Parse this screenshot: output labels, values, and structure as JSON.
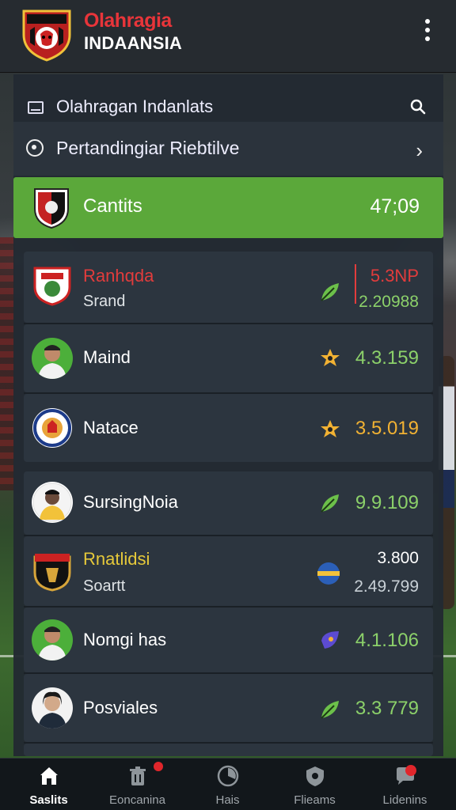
{
  "header": {
    "brand_line1": "Olahragia",
    "brand_line2": "INDAANSIA"
  },
  "search": {
    "label": "Olahragan Indanlats"
  },
  "nav_row": {
    "label": "Pertandingiar Riebtilve"
  },
  "highlight": {
    "title": "Cantits",
    "value": "47;09",
    "color": "#5ba83a"
  },
  "list": [
    {
      "name": "Ranhqda",
      "sub": "Srand",
      "value": "5.3NP",
      "value2": "2.20988",
      "name_color": "#e23c3c"
    },
    {
      "name": "Maind",
      "value": "4.3.159"
    },
    {
      "name": "Natace",
      "value": "3.5.019",
      "value_color": "#f2b233"
    },
    {
      "name": "SursingNoia",
      "value": "9.9.109"
    },
    {
      "name": "Rnatlidsi",
      "sub": "Soartt",
      "value": "3.800",
      "value2": "2.49.799",
      "name_color": "#e6c93a"
    },
    {
      "name": "Nomgi has",
      "value": "4.1.106"
    },
    {
      "name": "Posviales",
      "value": "3.3 779"
    }
  ],
  "bottom_nav": [
    {
      "label": "Saslits",
      "icon": "home-icon",
      "active": true
    },
    {
      "label": "Eoncanina",
      "icon": "trash-icon"
    },
    {
      "label": "Hais",
      "icon": "ball-icon"
    },
    {
      "label": "Flieams",
      "icon": "shield-icon"
    },
    {
      "label": "Lidenins",
      "icon": "chat-icon"
    }
  ],
  "colors": {
    "accent_green": "#8cd16a",
    "brand_red": "#e8353a",
    "gold": "#f2b233"
  }
}
